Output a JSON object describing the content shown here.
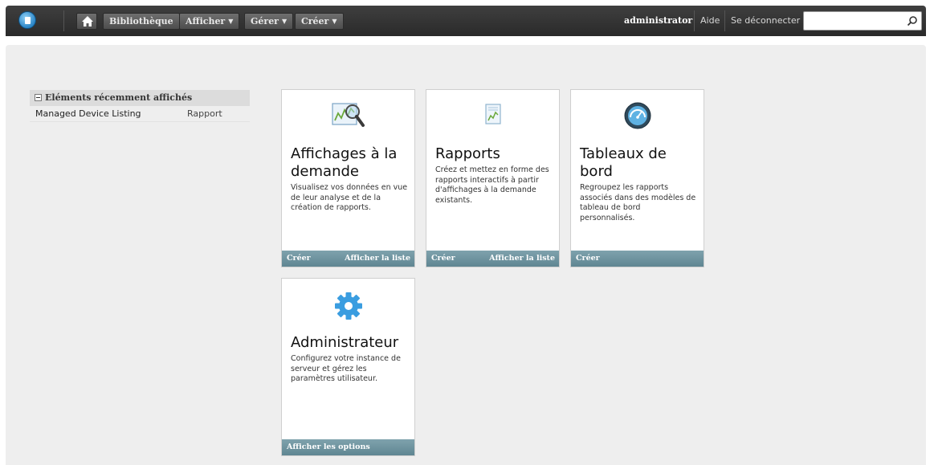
{
  "topbar": {
    "home_icon": "home-icon",
    "menus": {
      "library": "Bibliothèque",
      "view": "Afficher",
      "manage": "Gérer",
      "create": "Créer"
    },
    "user": "administrator",
    "help": "Aide",
    "logout": "Se déconnecter",
    "search": {
      "value": "",
      "placeholder": ""
    }
  },
  "recent": {
    "header": "Eléments récemment affichés",
    "items": [
      {
        "name": "Managed Device Listing",
        "type": "Rapport"
      }
    ]
  },
  "cards": {
    "adhoc": {
      "title": "Affichages à la demande",
      "description": "Visualisez vos données en vue de leur analyse et de la création de rapports.",
      "create": "Créer",
      "list": "Afficher la liste"
    },
    "reports": {
      "title": "Rapports",
      "description": "Créez et mettez en forme des rapports interactifs à partir d'affichages à la demande existants.",
      "create": "Créer",
      "list": "Afficher la liste"
    },
    "dashboards": {
      "title": "Tableaux de bord",
      "description": "Regroupez les rapports associés dans des modèles de tableau de bord personnalisés.",
      "create": "Créer"
    },
    "admin": {
      "title": "Administrateur",
      "description": "Configurez votre instance de serveur et gérez les paramètres utilisateur.",
      "options": "Afficher les options"
    }
  },
  "colors": {
    "topbar": "#333333",
    "panel": "#eeeeee",
    "card_footer": "#6f95a0"
  }
}
